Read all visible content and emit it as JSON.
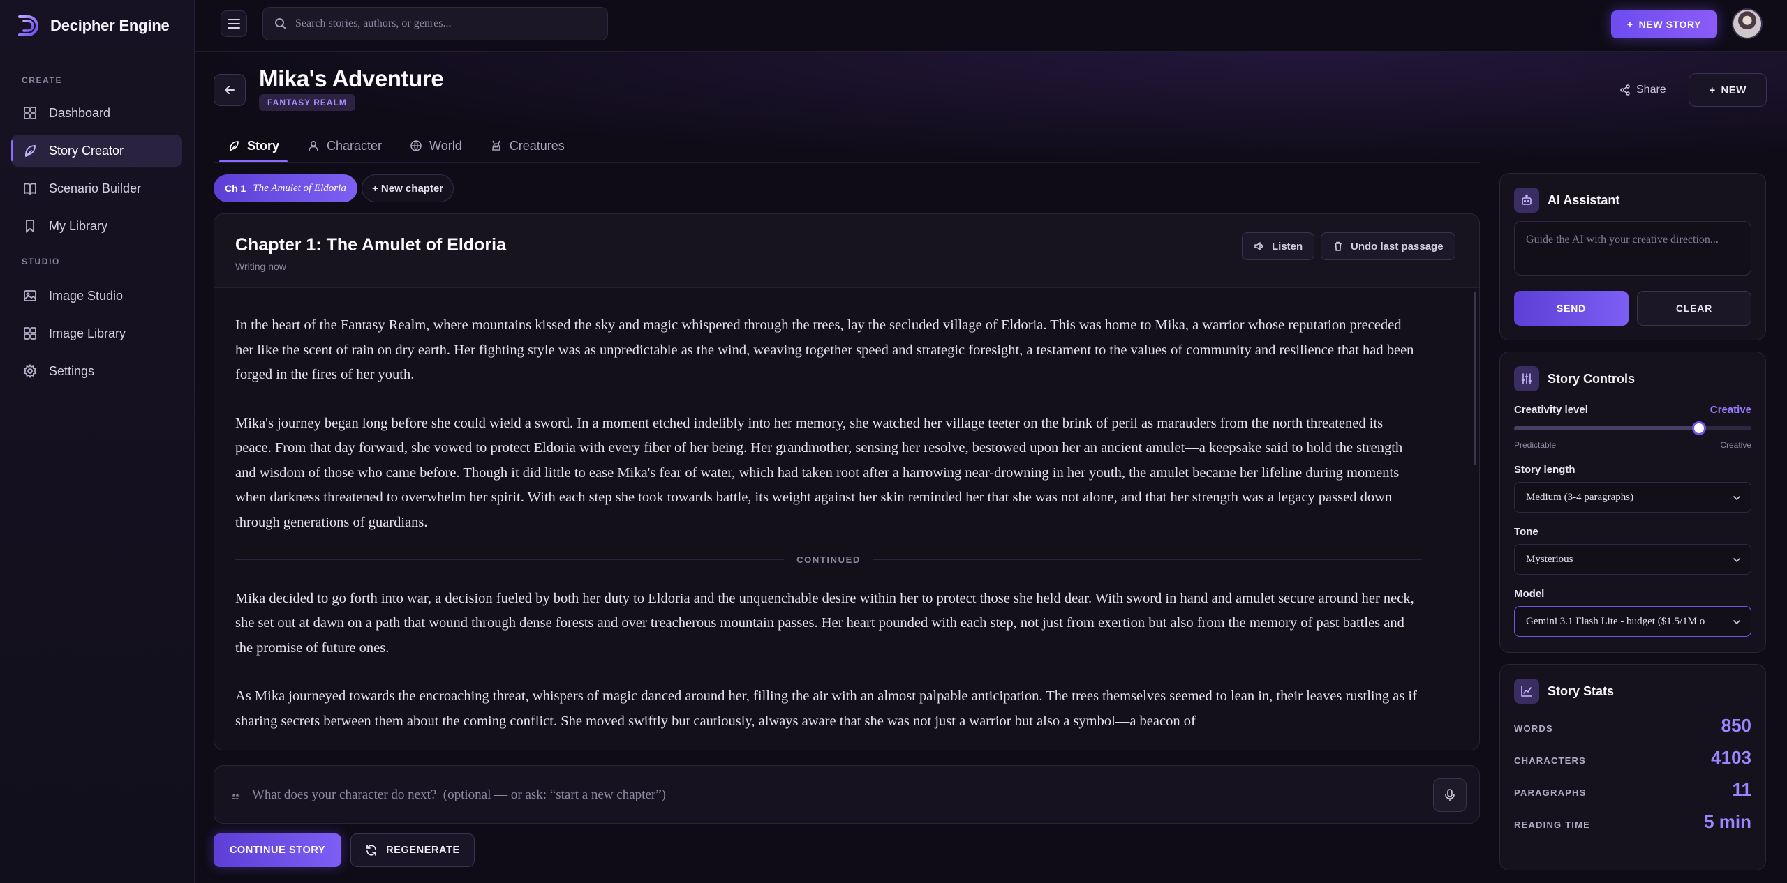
{
  "app": {
    "name": "Decipher Engine"
  },
  "sidebar": {
    "sections": [
      {
        "label": "CREATE"
      },
      {
        "label": "STUDIO"
      }
    ],
    "items": [
      {
        "label": "Dashboard",
        "icon": "grid-icon"
      },
      {
        "label": "Story Creator",
        "icon": "feather-icon",
        "active": true
      },
      {
        "label": "Scenario Builder",
        "icon": "book-icon"
      },
      {
        "label": "My Library",
        "icon": "bookmark-icon"
      },
      {
        "label": "Image Studio",
        "icon": "image-icon"
      },
      {
        "label": "Image Library",
        "icon": "grid-icon"
      },
      {
        "label": "Settings",
        "icon": "gear-icon"
      }
    ]
  },
  "topbar": {
    "search_placeholder": "Search stories, authors, or genres...",
    "new_story_label": "NEW STORY"
  },
  "header": {
    "title": "Mika's Adventure",
    "badge": "FANTASY REALM",
    "share_label": "Share",
    "new_label": "NEW"
  },
  "tabs": [
    {
      "label": "Story",
      "icon": "feather-icon",
      "active": true
    },
    {
      "label": "Character",
      "icon": "user-icon"
    },
    {
      "label": "World",
      "icon": "globe-icon"
    },
    {
      "label": "Creatures",
      "icon": "creature-icon"
    }
  ],
  "chapters": {
    "current_num": "Ch 1",
    "current_name": "The Amulet of Eldoria",
    "new_label": "+ New chapter"
  },
  "editor": {
    "chapter_title": "Chapter 1: The Amulet of Eldoria",
    "status": "Writing now",
    "listen_label": "Listen",
    "undo_label": "Undo last passage",
    "paragraphs_before": [
      "In the heart of the Fantasy Realm, where mountains kissed the sky and magic whispered through the trees, lay the secluded village of Eldoria. This was home to Mika, a warrior whose reputation preceded her like the scent of rain on dry earth. Her fighting style was as unpredictable as the wind, weaving together speed and strategic foresight, a testament to the values of community and resilience that had been forged in the fires of her youth.",
      "Mika's journey began long before she could wield a sword. In a moment etched indelibly into her memory, she watched her village teeter on the brink of peril as marauders from the north threatened its peace. From that day forward, she vowed to protect Eldoria with every fiber of her being. Her grandmother, sensing her resolve, bestowed upon her an ancient amulet—a keepsake said to hold the strength and wisdom of those who came before. Though it did little to ease Mika's fear of water, which had taken root after a harrowing near-drowning in her youth, the amulet became her lifeline during moments when darkness threatened to overwhelm her spirit. With each step she took towards battle, its weight against her skin reminded her that she was not alone, and that her strength was a legacy passed down through generations of guardians."
    ],
    "divider_label": "CONTINUED",
    "paragraphs_after": [
      "Mika decided to go forth into war, a decision fueled by both her duty to Eldoria and the unquenchable desire within her to protect those she held dear. With sword in hand and amulet secure around her neck, she set out at dawn on a path that wound through dense forests and over treacherous mountain passes. Her heart pounded with each step, not just from exertion but also from the memory of past battles and the promise of future ones.",
      "As Mika journeyed towards the encroaching threat, whispers of magic danced around her, filling the air with an almost palpable anticipation. The trees themselves seemed to lean in, their leaves rustling as if sharing secrets between them about the coming conflict. She moved swiftly but cautiously, always aware that she was not just a warrior but also a symbol—a beacon of"
    ]
  },
  "prompt": {
    "placeholder": "What does your character do next?  (optional — or ask: “start a new chapter”)"
  },
  "actions": {
    "continue_label": "CONTINUE STORY",
    "regenerate_label": "REGENERATE"
  },
  "ai_assistant": {
    "title": "AI Assistant",
    "placeholder": "Guide the AI with your creative direction...",
    "send_label": "SEND",
    "clear_label": "CLEAR"
  },
  "story_controls": {
    "title": "Story Controls",
    "creativity_label": "Creativity level",
    "creativity_value": "Creative",
    "creativity_level": 0.78,
    "min_label": "Predictable",
    "max_label": "Creative",
    "length_label": "Story length",
    "length_value": "Medium (3-4 paragraphs)",
    "tone_label": "Tone",
    "tone_value": "Mysterious",
    "model_label": "Model",
    "model_value": "Gemini 3.1 Flash Lite - budget ($1.5/1M o"
  },
  "story_stats": {
    "title": "Story Stats",
    "rows": [
      {
        "label": "WORDS",
        "value": "850"
      },
      {
        "label": "CHARACTERS",
        "value": "4103"
      },
      {
        "label": "PARAGRAPHS",
        "value": "11"
      },
      {
        "label": "READING TIME",
        "value": "5 min"
      }
    ]
  },
  "colors": {
    "accent": "#8b5cf6",
    "accent_light": "#9c86ff",
    "background": "#0f0c18"
  }
}
